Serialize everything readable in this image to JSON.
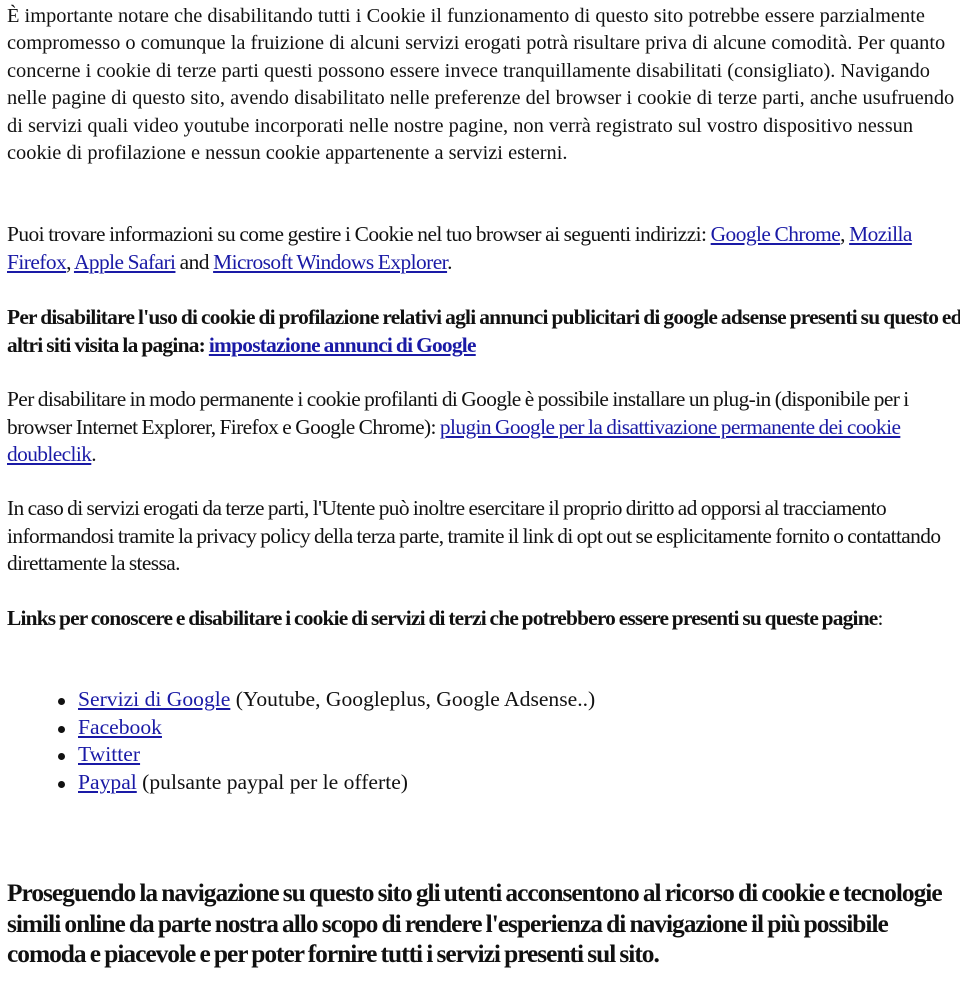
{
  "intro": {
    "text": "È importante notare che disabilitando tutti i Cookie il funzionamento di questo sito potrebbe essere parzialmente compromesso o comunque la fruizione di alcuni servizi erogati potrà risultare priva di alcune comodità. Per quanto concerne i cookie di terze parti questi possono essere invece tranquillamente disabilitati (consigliato). Navigando nelle pagine di questo sito, avendo disabilitato nelle preferenze del browser i cookie di terze parti, anche usufruendo di servizi quali video youtube incorporati nelle nostre pagine, non verrà registrato sul vostro dispositivo nessun cookie di profilazione e nessun cookie appartenente a servizi esterni."
  },
  "browsers": {
    "prefix": "Puoi trovare informazioni su come gestire i Cookie nel tuo browser ai seguenti indirizzi: ",
    "links": [
      {
        "label": "Google Chrome"
      },
      {
        "label": "Mozilla Firefox"
      },
      {
        "label": "Apple Safari"
      },
      {
        "label": "Microsoft Windows Explorer"
      }
    ],
    "sep1": ", ",
    "sep2": ", ",
    "sep3": " and ",
    "suffix": "."
  },
  "adsense": {
    "text": "Per disabilitare l'uso di cookie di profilazione relativi agli annunci publicitari di google adsense presenti su questo ed altri siti visita la pagina: ",
    "link": "impostazione annunci di Google"
  },
  "plugin": {
    "text": "Per disabilitare in modo permanente i cookie profilanti di Google è possibile installare un plug-in (disponibile per i browser Internet Explorer, Firefox e Google Chrome): ",
    "link": "plugin Google per la disattivazione permanente dei cookie doubleclik",
    "suffix": "."
  },
  "thirdparty": {
    "text": "In caso di servizi erogati da terze parti, l'Utente può inoltre esercitare il proprio diritto ad opporsi al tracciamento informandosi tramite la privacy policy della terza parte, tramite il link di opt out se esplicitamente fornito o contattando direttamente la stessa."
  },
  "links_heading": {
    "text": "Links per conoscere e disabilitare i cookie di servizi di terzi che potrebbero essere presenti su queste pagine",
    "colon": ":"
  },
  "service_links": [
    {
      "label": "Servizi di Google",
      "note": " (Youtube, Googleplus, Google Adsense..)"
    },
    {
      "label": "Facebook",
      "note": ""
    },
    {
      "label": "Twitter",
      "note": ""
    },
    {
      "label": "Paypal",
      "note": " (pulsante paypal per le offerte)"
    }
  ],
  "consent": {
    "text": "Proseguendo la navigazione su questo sito gli utenti acconsentono al ricorso di cookie e tecnologie simili online da parte nostra allo scopo di rendere l'esperienza di navigazione il più possibile comoda e piacevole e per poter fornire tutti i servizi presenti sul sito."
  },
  "colors": {
    "link": "#1a1aa6",
    "text": "#111111",
    "background": "#ffffff"
  }
}
